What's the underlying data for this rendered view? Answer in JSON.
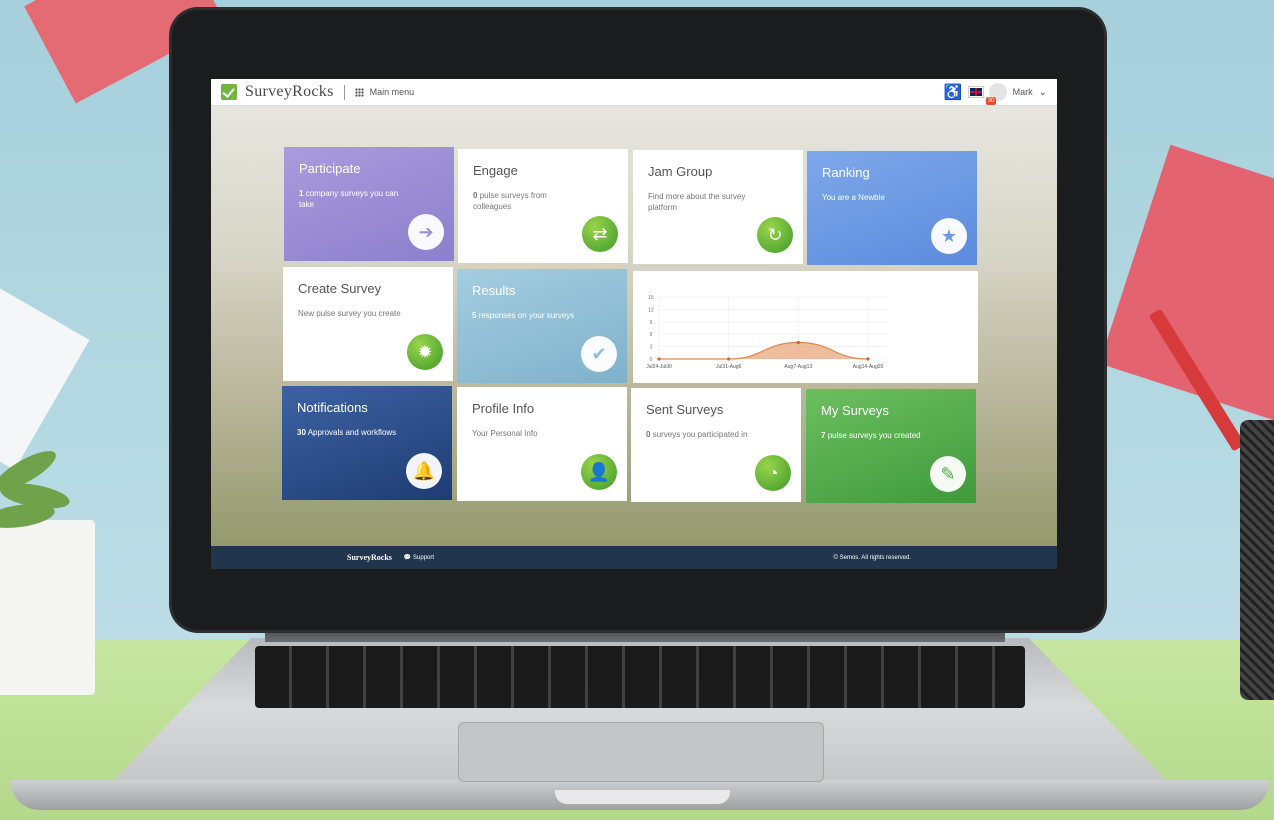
{
  "app": {
    "brand": "SurveyRocks",
    "menu_label": "Main menu",
    "user_name": "Mark",
    "notification_count": "30"
  },
  "tiles": {
    "participate": {
      "title": "Participate",
      "count": "1",
      "desc": "company surveys you can take"
    },
    "engage": {
      "title": "Engage",
      "count": "0",
      "desc": "pulse surveys from colleagues"
    },
    "jam": {
      "title": "Jam Group",
      "desc": "Find more about the survey platform"
    },
    "ranking": {
      "title": "Ranking",
      "desc": "You are a Newbie"
    },
    "create": {
      "title": "Create Survey",
      "desc": "New pulse survey you create"
    },
    "results": {
      "title": "Results",
      "count": "5",
      "desc": "responses on your surveys"
    },
    "notifications": {
      "title": "Notifications",
      "count": "30",
      "desc": "Approvals and workflows"
    },
    "profile": {
      "title": "Profile Info",
      "desc": "Your Personal Info"
    },
    "sent": {
      "title": "Sent Surveys",
      "count": "0",
      "desc": "surveys you participated in"
    },
    "mine": {
      "title": "My Surveys",
      "count": "7",
      "desc": "pulse surveys you created"
    }
  },
  "chart_data": {
    "type": "area",
    "categories": [
      "Jul24-Jul30",
      "Jul31-Aug6",
      "Aug7-Aug13",
      "Aug14-Aug20"
    ],
    "values": [
      0,
      0,
      4,
      0
    ],
    "yticks": [
      0,
      3,
      6,
      9,
      12,
      15
    ],
    "ylim": [
      0,
      15
    ],
    "color": "#e0874f"
  },
  "footer": {
    "brand": "SurveyRocks",
    "support": "Support",
    "copyright": "© Semos. All rights reserved."
  },
  "colors": {
    "participate": "#9d8fd6",
    "ranking": "#6f9be6",
    "results": "#8fbfd9",
    "notifications": "#2f4f8a",
    "mine": "#4fa74a",
    "footer": "#21364c"
  }
}
